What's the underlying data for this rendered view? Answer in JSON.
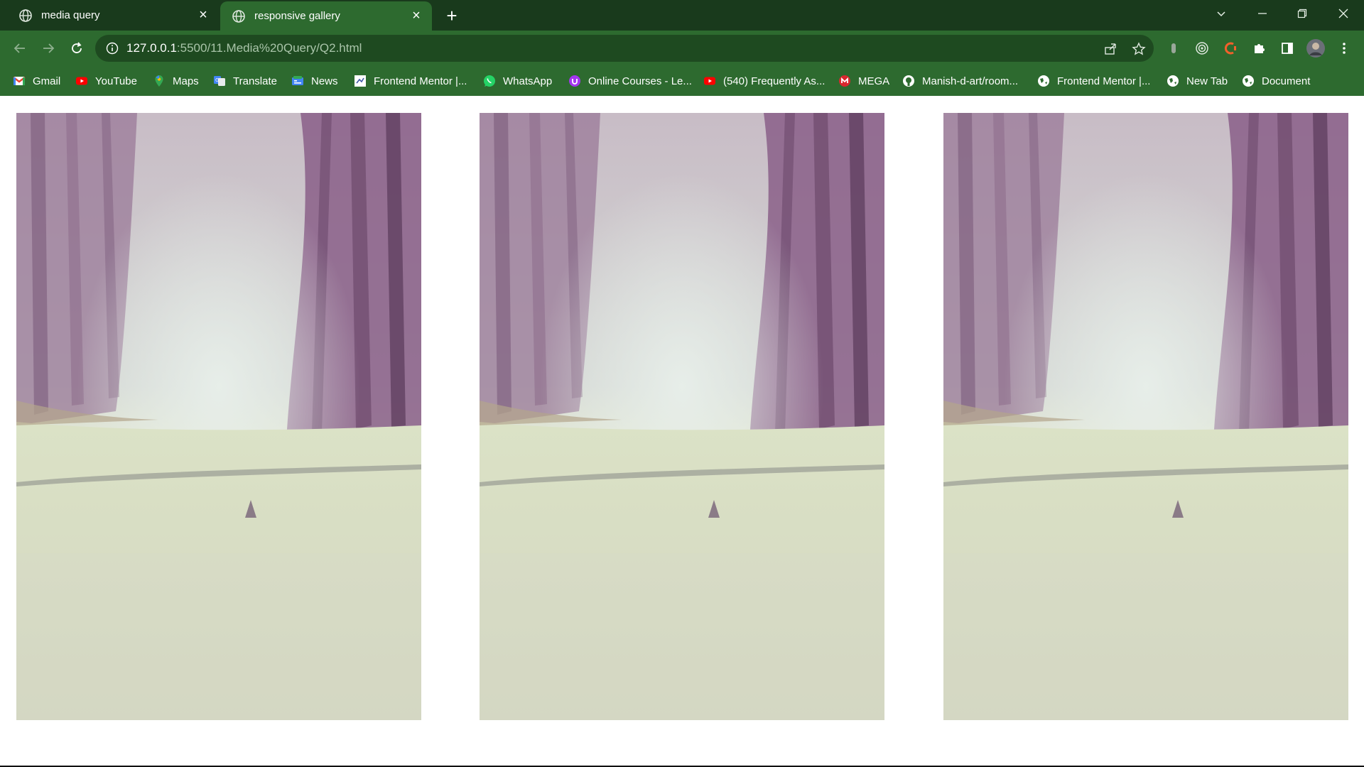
{
  "tabs": [
    {
      "title": "media query",
      "active": false,
      "icon": "globe-icon"
    },
    {
      "title": "responsive gallery",
      "active": true,
      "icon": "globe-icon"
    }
  ],
  "new_tab_label": "+",
  "window_controls": [
    "chevron-down-icon",
    "minimize-icon",
    "restore-icon",
    "close-icon"
  ],
  "address_bar": {
    "url_host": "127.0.0.1",
    "url_rest": ":5500/11.Media%20Query/Q2.html"
  },
  "bookmarks": [
    {
      "label": "Gmail",
      "icon": "gmail-icon"
    },
    {
      "label": "YouTube",
      "icon": "youtube-icon"
    },
    {
      "label": "Maps",
      "icon": "maps-icon"
    },
    {
      "label": "Translate",
      "icon": "translate-icon"
    },
    {
      "label": "News",
      "icon": "news-icon"
    },
    {
      "label": "Frontend Mentor |...",
      "icon": "frontend-mentor-icon"
    },
    {
      "label": "WhatsApp",
      "icon": "whatsapp-icon"
    },
    {
      "label": "Online Courses - Le...",
      "icon": "udemy-icon"
    },
    {
      "label": "(540) Frequently As...",
      "icon": "youtube-icon"
    },
    {
      "label": "MEGA",
      "icon": "mega-icon"
    },
    {
      "label": "Manish-d-art/room...",
      "icon": "github-icon"
    },
    {
      "label": "Frontend Mentor |...",
      "icon": "globe-icon"
    },
    {
      "label": "New Tab",
      "icon": "globe-icon"
    },
    {
      "label": "Document",
      "icon": "globe-icon"
    }
  ],
  "gallery": {
    "images": [
      {
        "alt": "misty forest path"
      },
      {
        "alt": "misty forest path"
      },
      {
        "alt": "misty forest path"
      }
    ]
  },
  "colors": {
    "tabstrip": "#193a1c",
    "toolbar": "#2d6a2f",
    "omnibox": "#1e4a20"
  }
}
